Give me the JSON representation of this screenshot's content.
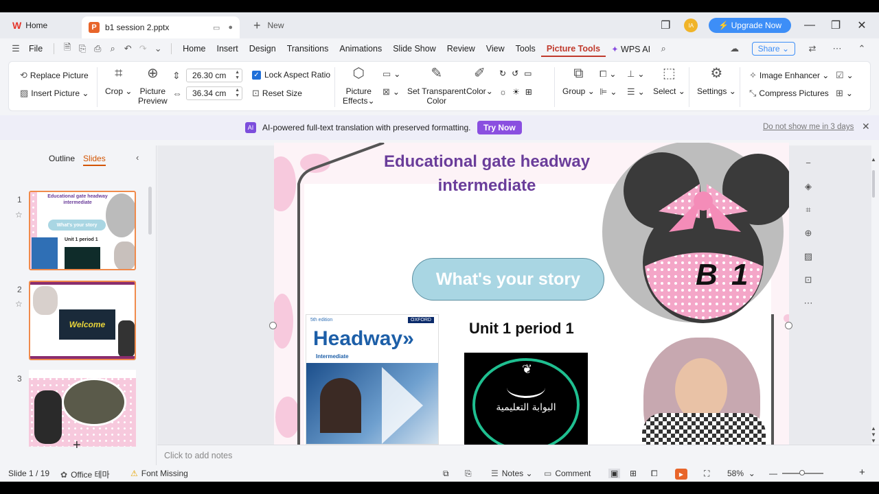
{
  "titlebar": {
    "home_tab": "Home",
    "doc_tab": "b1 session 2.pptx",
    "new_tab": "New",
    "upgrade": "Upgrade Now"
  },
  "menu": {
    "file": "File",
    "items": [
      "Home",
      "Insert",
      "Design",
      "Transitions",
      "Animations",
      "Slide Show",
      "Review",
      "View",
      "Tools",
      "Picture Tools",
      "WPS AI"
    ],
    "share": "Share"
  },
  "ribbon": {
    "replace_picture": "Replace Picture",
    "insert_picture": "Insert  Picture",
    "crop": "Crop",
    "picture_preview_1": "Picture",
    "picture_preview_2": "Preview",
    "height": "26.30 cm",
    "width": "36.34 cm",
    "lock_aspect": "Lock Aspect Ratio",
    "reset_size": "Reset Size",
    "picture_effects_1": "Picture",
    "picture_effects_2": "Effects",
    "set_transparent_1": "Set Transparent",
    "set_transparent_2": "Color",
    "color": "Color",
    "group": "Group",
    "select": "Select",
    "settings": "Settings",
    "image_enhancer": "Image Enhancer",
    "compress_pictures": "Compress  Pictures"
  },
  "banner": {
    "ai_badge": "AI",
    "text": "AI-powered full-text translation with preserved formatting.",
    "try_now": "Try Now",
    "dont_show": "Do not show me in 3 days"
  },
  "panel": {
    "outline": "Outline",
    "slides": "Slides",
    "thumbs": [
      {
        "num": "1",
        "title": "Educational gate headway intermediate",
        "story": "What's your story",
        "unit": "Unit 1 period 1"
      },
      {
        "num": "2",
        "welcome": "Welcome"
      },
      {
        "num": "3"
      }
    ]
  },
  "slide": {
    "title_line1": "Educational gate headway",
    "title_line2": "intermediate",
    "story_button": "What's your story",
    "level": "B 1",
    "unit": "Unit 1 period 1",
    "book_title": "Headway",
    "book_sub": "Intermediate",
    "book_edition": "5th edition",
    "book_publisher": "OXFORD",
    "logo_text": "البوابة التعليمية"
  },
  "notes": {
    "placeholder": "Click to add notes"
  },
  "status": {
    "slide": "Slide 1 / 19",
    "theme": "Office 테마",
    "font_missing": "Font Missing",
    "notes": "Notes",
    "comment": "Comment",
    "zoom": "58%"
  },
  "colors": {
    "accent": "#d35400",
    "title_purple": "#6a3d9a",
    "pill": "#a9d6e3",
    "upgrade": "#3d8ef7",
    "try_now": "#8a4fe0"
  }
}
